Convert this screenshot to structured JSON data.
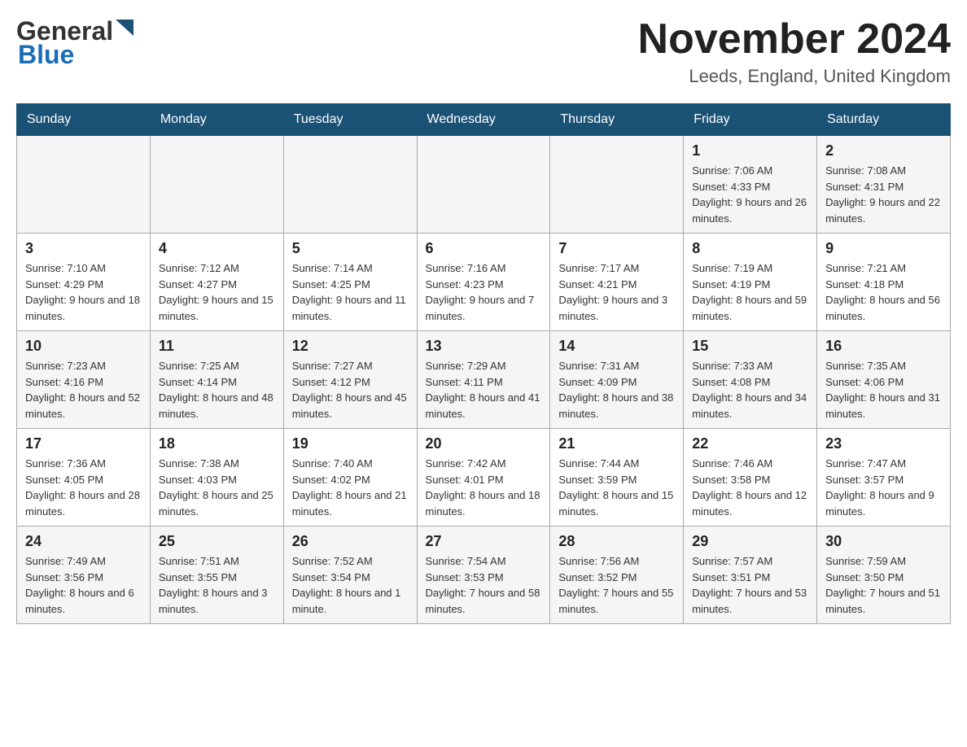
{
  "header": {
    "logo": {
      "general": "General",
      "blue": "Blue"
    },
    "title": "November 2024",
    "location": "Leeds, England, United Kingdom"
  },
  "weekdays": [
    "Sunday",
    "Monday",
    "Tuesday",
    "Wednesday",
    "Thursday",
    "Friday",
    "Saturday"
  ],
  "weeks": [
    [
      {
        "day": "",
        "info": ""
      },
      {
        "day": "",
        "info": ""
      },
      {
        "day": "",
        "info": ""
      },
      {
        "day": "",
        "info": ""
      },
      {
        "day": "",
        "info": ""
      },
      {
        "day": "1",
        "info": "Sunrise: 7:06 AM\nSunset: 4:33 PM\nDaylight: 9 hours and 26 minutes."
      },
      {
        "day": "2",
        "info": "Sunrise: 7:08 AM\nSunset: 4:31 PM\nDaylight: 9 hours and 22 minutes."
      }
    ],
    [
      {
        "day": "3",
        "info": "Sunrise: 7:10 AM\nSunset: 4:29 PM\nDaylight: 9 hours and 18 minutes."
      },
      {
        "day": "4",
        "info": "Sunrise: 7:12 AM\nSunset: 4:27 PM\nDaylight: 9 hours and 15 minutes."
      },
      {
        "day": "5",
        "info": "Sunrise: 7:14 AM\nSunset: 4:25 PM\nDaylight: 9 hours and 11 minutes."
      },
      {
        "day": "6",
        "info": "Sunrise: 7:16 AM\nSunset: 4:23 PM\nDaylight: 9 hours and 7 minutes."
      },
      {
        "day": "7",
        "info": "Sunrise: 7:17 AM\nSunset: 4:21 PM\nDaylight: 9 hours and 3 minutes."
      },
      {
        "day": "8",
        "info": "Sunrise: 7:19 AM\nSunset: 4:19 PM\nDaylight: 8 hours and 59 minutes."
      },
      {
        "day": "9",
        "info": "Sunrise: 7:21 AM\nSunset: 4:18 PM\nDaylight: 8 hours and 56 minutes."
      }
    ],
    [
      {
        "day": "10",
        "info": "Sunrise: 7:23 AM\nSunset: 4:16 PM\nDaylight: 8 hours and 52 minutes."
      },
      {
        "day": "11",
        "info": "Sunrise: 7:25 AM\nSunset: 4:14 PM\nDaylight: 8 hours and 48 minutes."
      },
      {
        "day": "12",
        "info": "Sunrise: 7:27 AM\nSunset: 4:12 PM\nDaylight: 8 hours and 45 minutes."
      },
      {
        "day": "13",
        "info": "Sunrise: 7:29 AM\nSunset: 4:11 PM\nDaylight: 8 hours and 41 minutes."
      },
      {
        "day": "14",
        "info": "Sunrise: 7:31 AM\nSunset: 4:09 PM\nDaylight: 8 hours and 38 minutes."
      },
      {
        "day": "15",
        "info": "Sunrise: 7:33 AM\nSunset: 4:08 PM\nDaylight: 8 hours and 34 minutes."
      },
      {
        "day": "16",
        "info": "Sunrise: 7:35 AM\nSunset: 4:06 PM\nDaylight: 8 hours and 31 minutes."
      }
    ],
    [
      {
        "day": "17",
        "info": "Sunrise: 7:36 AM\nSunset: 4:05 PM\nDaylight: 8 hours and 28 minutes."
      },
      {
        "day": "18",
        "info": "Sunrise: 7:38 AM\nSunset: 4:03 PM\nDaylight: 8 hours and 25 minutes."
      },
      {
        "day": "19",
        "info": "Sunrise: 7:40 AM\nSunset: 4:02 PM\nDaylight: 8 hours and 21 minutes."
      },
      {
        "day": "20",
        "info": "Sunrise: 7:42 AM\nSunset: 4:01 PM\nDaylight: 8 hours and 18 minutes."
      },
      {
        "day": "21",
        "info": "Sunrise: 7:44 AM\nSunset: 3:59 PM\nDaylight: 8 hours and 15 minutes."
      },
      {
        "day": "22",
        "info": "Sunrise: 7:46 AM\nSunset: 3:58 PM\nDaylight: 8 hours and 12 minutes."
      },
      {
        "day": "23",
        "info": "Sunrise: 7:47 AM\nSunset: 3:57 PM\nDaylight: 8 hours and 9 minutes."
      }
    ],
    [
      {
        "day": "24",
        "info": "Sunrise: 7:49 AM\nSunset: 3:56 PM\nDaylight: 8 hours and 6 minutes."
      },
      {
        "day": "25",
        "info": "Sunrise: 7:51 AM\nSunset: 3:55 PM\nDaylight: 8 hours and 3 minutes."
      },
      {
        "day": "26",
        "info": "Sunrise: 7:52 AM\nSunset: 3:54 PM\nDaylight: 8 hours and 1 minute."
      },
      {
        "day": "27",
        "info": "Sunrise: 7:54 AM\nSunset: 3:53 PM\nDaylight: 7 hours and 58 minutes."
      },
      {
        "day": "28",
        "info": "Sunrise: 7:56 AM\nSunset: 3:52 PM\nDaylight: 7 hours and 55 minutes."
      },
      {
        "day": "29",
        "info": "Sunrise: 7:57 AM\nSunset: 3:51 PM\nDaylight: 7 hours and 53 minutes."
      },
      {
        "day": "30",
        "info": "Sunrise: 7:59 AM\nSunset: 3:50 PM\nDaylight: 7 hours and 51 minutes."
      }
    ]
  ]
}
